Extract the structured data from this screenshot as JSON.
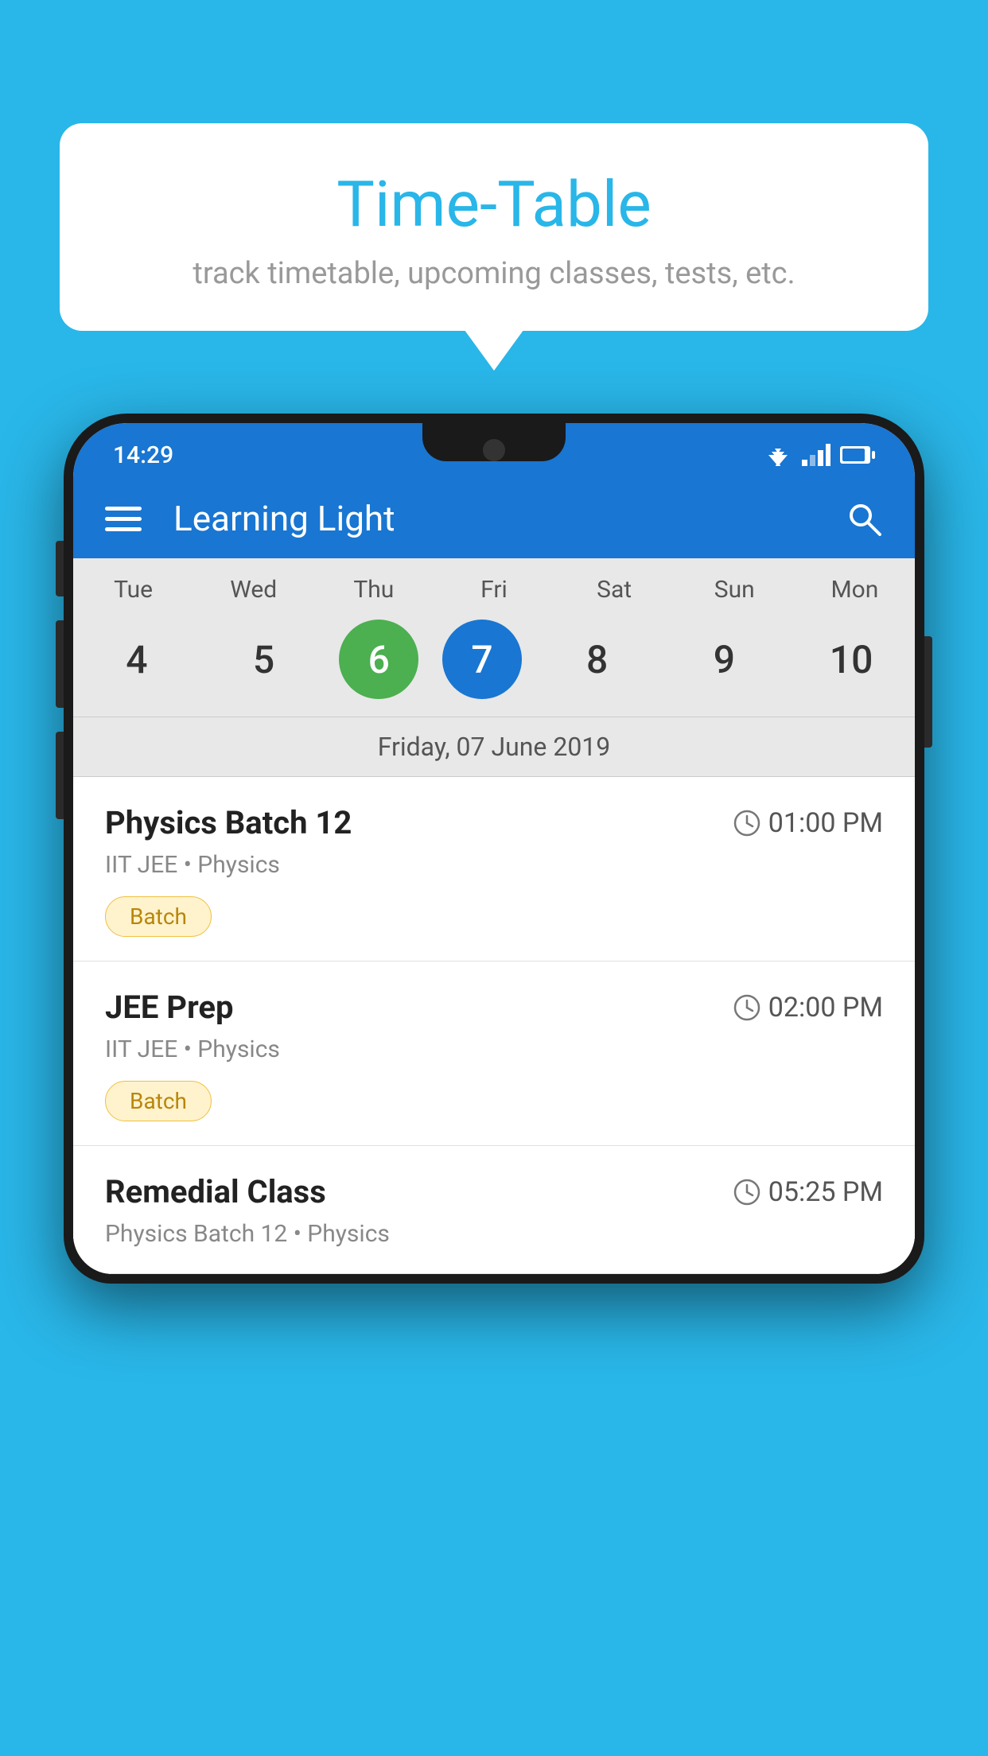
{
  "background_color": "#29b6e8",
  "tooltip": {
    "title": "Time-Table",
    "subtitle": "track timetable, upcoming classes, tests, etc."
  },
  "phone": {
    "status_bar": {
      "time": "14:29"
    },
    "app_bar": {
      "title": "Learning Light"
    },
    "calendar": {
      "days": [
        "Tue",
        "Wed",
        "Thu",
        "Fri",
        "Sat",
        "Sun",
        "Mon"
      ],
      "dates": [
        4,
        5,
        6,
        7,
        8,
        9,
        10
      ],
      "today_index": 2,
      "selected_index": 3,
      "selected_date_label": "Friday, 07 June 2019"
    },
    "schedule": [
      {
        "title": "Physics Batch 12",
        "time": "01:00 PM",
        "subtitle": "IIT JEE • Physics",
        "badge": "Batch"
      },
      {
        "title": "JEE Prep",
        "time": "02:00 PM",
        "subtitle": "IIT JEE • Physics",
        "badge": "Batch"
      },
      {
        "title": "Remedial Class",
        "time": "05:25 PM",
        "subtitle": "Physics Batch 12 • Physics",
        "badge": null
      }
    ]
  }
}
